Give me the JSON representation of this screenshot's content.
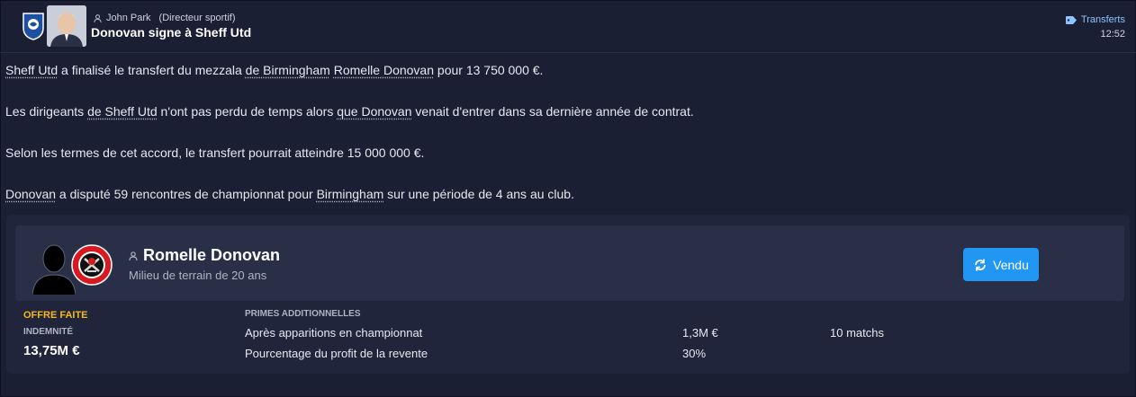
{
  "header": {
    "sender_name": "John Park",
    "sender_role": "(Directeur sportif)",
    "title": "Donovan signe à Sheff Utd",
    "category": "Transferts",
    "time": "12:52"
  },
  "body": {
    "p1": {
      "a": "Sheff Utd",
      "b": " a finalisé le transfert du mezzala ",
      "c": "de Birmingham",
      "d": " ",
      "e": "Romelle Donovan",
      "f": " pour 13 750 000 €."
    },
    "p2": {
      "a": "Les dirigeants ",
      "b": "de Sheff Utd",
      "c": " n'ont pas perdu de temps alors ",
      "d": "que Donovan",
      "e": " venait d'entrer dans sa dernière année de contrat."
    },
    "p3": "Selon les termes de cet accord, le transfert pourrait atteindre 15 000 000 €.",
    "p4": {
      "a": "Donovan",
      "b": " a disputé 59 rencontres de championnat pour ",
      "c": "Birmingham",
      "d": " sur une période de 4 ans au club."
    }
  },
  "player": {
    "name": "Romelle Donovan",
    "position": "Milieu de terrain de 20 ans",
    "button_label": "Vendu"
  },
  "offer": {
    "status": "OFFRE FAITE",
    "fee_label": "INDEMNITÉ",
    "fee_value": "13,75M €"
  },
  "bonuses": {
    "title": "PRIMES ADDITIONNELLES",
    "rows": [
      {
        "label": "Après apparitions en championnat",
        "value": "1,3M €",
        "extra": "10 matchs"
      },
      {
        "label": "Pourcentage du profit de la revente",
        "value": "30%",
        "extra": ""
      }
    ]
  },
  "colors": {
    "accent": "#2196f3",
    "offer": "#f5b81c",
    "background": "#1a1f33"
  },
  "icons": {
    "sender": "person-icon",
    "tag": "tag-icon",
    "button": "refresh-icon"
  }
}
